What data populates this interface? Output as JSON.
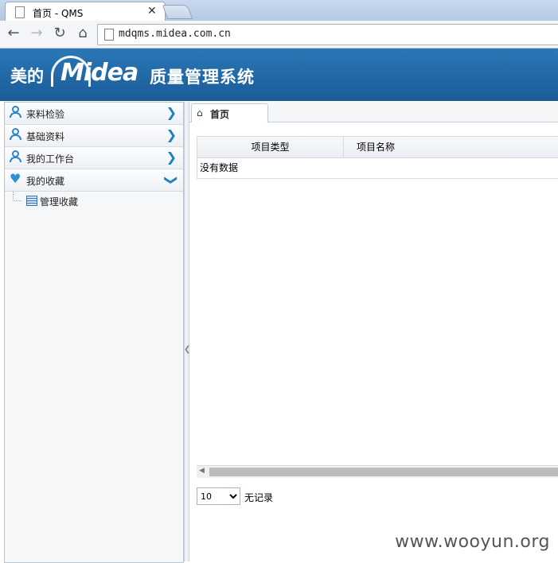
{
  "browser": {
    "tab_title": "首页 - QMS",
    "url": "mdqms.midea.com.cn"
  },
  "header": {
    "brand_cn": "美的",
    "brand_en": "Midea",
    "system_title": "质量管理系统"
  },
  "sidebar": {
    "items": [
      {
        "label": "来料检验",
        "icon": "user-icon",
        "state": "collapsed"
      },
      {
        "label": "基础资料",
        "icon": "user-icon",
        "state": "collapsed"
      },
      {
        "label": "我的工作台",
        "icon": "user-icon",
        "state": "collapsed"
      },
      {
        "label": "我的收藏",
        "icon": "heart-icon",
        "state": "expanded"
      }
    ],
    "subitems": [
      {
        "label": "管理收藏",
        "icon": "grid-icon"
      }
    ]
  },
  "main": {
    "tab_label": "首页",
    "columns": [
      "项目类型",
      "项目名称"
    ],
    "empty_text": "没有数据",
    "page_size": "10",
    "no_records": "无记录"
  },
  "watermark": "www.wooyun.org",
  "colors": {
    "header_blue": "#1f69a8",
    "accent": "#1e7fc4"
  }
}
